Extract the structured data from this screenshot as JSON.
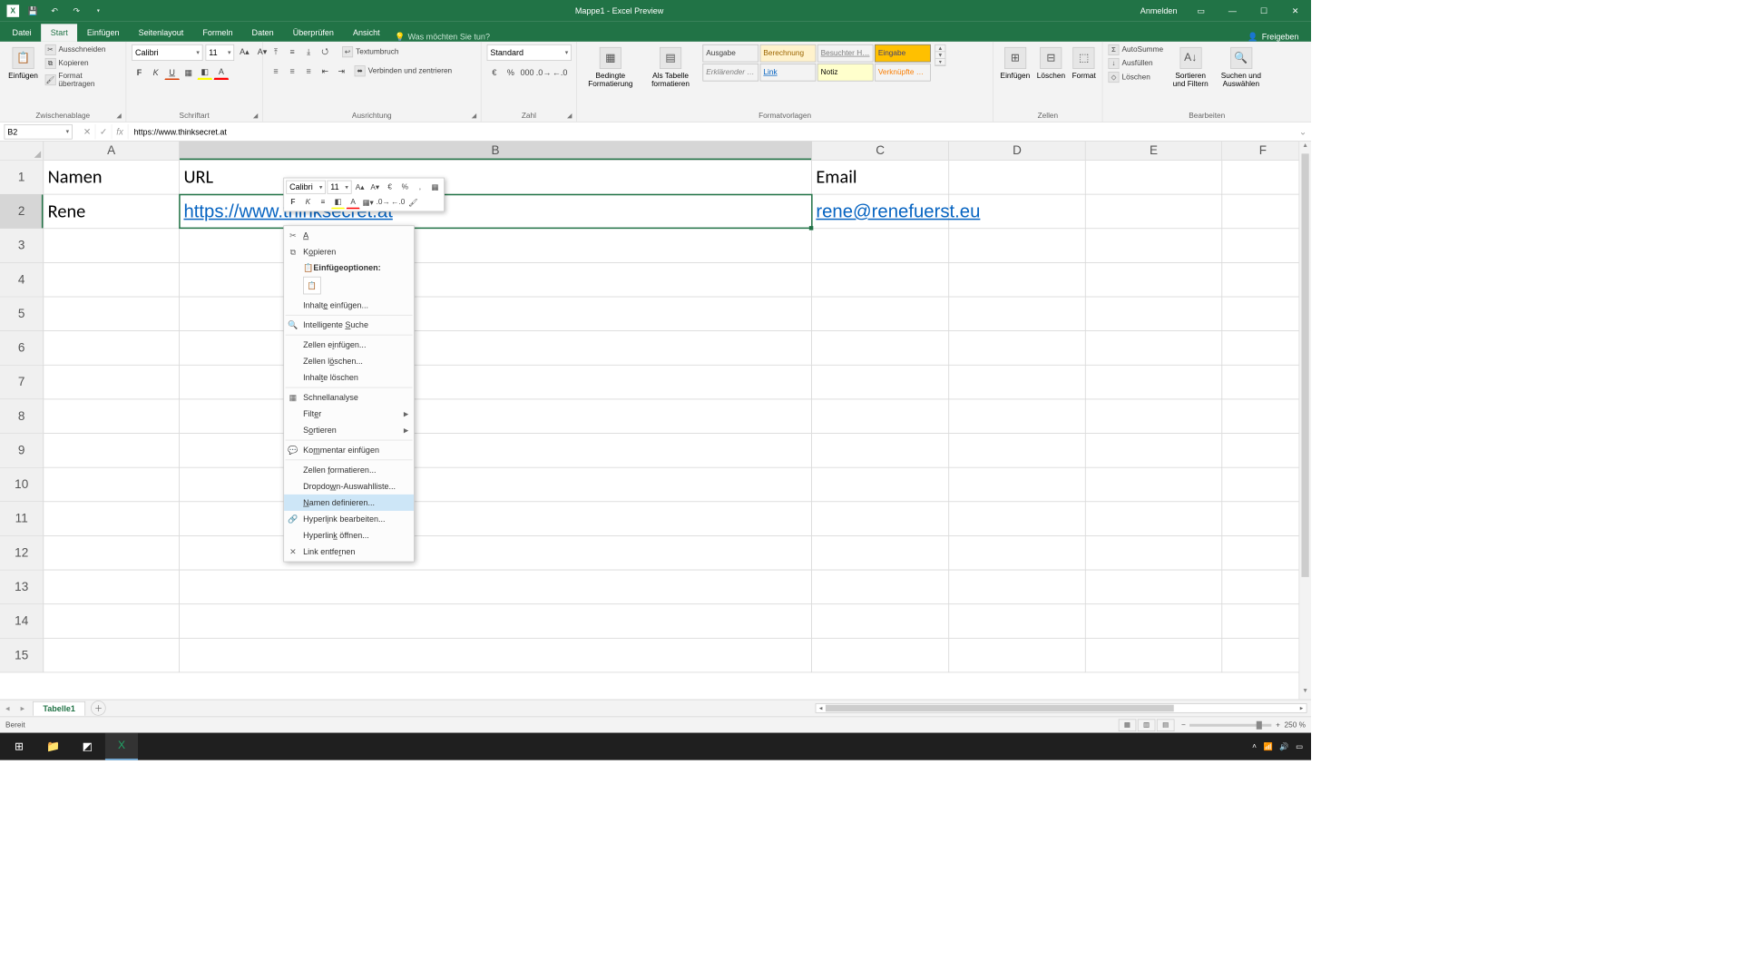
{
  "title": "Mappe1 - Excel Preview",
  "account": "Anmelden",
  "tabs": {
    "file": "Datei",
    "home": "Start",
    "insert": "Einfügen",
    "layout": "Seitenlayout",
    "formulas": "Formeln",
    "data": "Daten",
    "review": "Überprüfen",
    "view": "Ansicht",
    "tellme": "Was möchten Sie tun?"
  },
  "share": "Freigeben",
  "ribbon": {
    "clipboard": {
      "paste": "Einfügen",
      "cut": "Ausschneiden",
      "copy": "Kopieren",
      "painter": "Format übertragen",
      "label": "Zwischenablage"
    },
    "font": {
      "name": "Calibri",
      "size": "11",
      "label": "Schriftart"
    },
    "align": {
      "wrap": "Textumbruch",
      "merge": "Verbinden und zentrieren",
      "label": "Ausrichtung"
    },
    "number": {
      "format": "Standard",
      "label": "Zahl"
    },
    "styles": {
      "cond": "Bedingte Formatierung",
      "table": "Als Tabelle formatieren",
      "ausgabe": "Ausgabe",
      "berechnung": "Berechnung",
      "besucht": "Besuchter H…",
      "eingabe": "Eingabe",
      "erkl": "Erklärender …",
      "link": "Link",
      "notiz": "Notiz",
      "verkn": "Verknüpfte …",
      "label": "Formatvorlagen"
    },
    "cells": {
      "insert": "Einfügen",
      "delete": "Löschen",
      "format": "Format",
      "label": "Zellen"
    },
    "editing": {
      "autosum": "AutoSumme",
      "fill": "Ausfüllen",
      "clear": "Löschen",
      "sort": "Sortieren und Filtern",
      "find": "Suchen und Auswählen",
      "label": "Bearbeiten"
    }
  },
  "namebox": "B2",
  "formula": "https://www.thinksecret.at",
  "columns": [
    "A",
    "B",
    "C",
    "D",
    "E",
    "F"
  ],
  "data_rows": [
    {
      "n": "1",
      "A": "Namen",
      "B": "URL",
      "C": "Email"
    },
    {
      "n": "2",
      "A": "Rene",
      "B": "https://www.thinksecret.at",
      "C": "rene@renefuerst.eu",
      "link": true
    }
  ],
  "empty_rows": [
    "3",
    "4",
    "5",
    "6",
    "7",
    "8",
    "9",
    "10",
    "11",
    "12",
    "13",
    "14",
    "15"
  ],
  "mini": {
    "font": "Calibri",
    "size": "11"
  },
  "ctx": {
    "cut": "Ausschneiden",
    "copy": "Kopieren",
    "paste_opts": "Einfügeoptionen:",
    "paste_special": "Inhalte einfügen...",
    "smart": "Intelligente Suche",
    "ins": "Zellen einfügen...",
    "del": "Zellen löschen...",
    "clear": "Inhalte löschen",
    "quick": "Schnellanalyse",
    "filter": "Filter",
    "sort": "Sortieren",
    "comment": "Kommentar einfügen",
    "fmt": "Zellen formatieren...",
    "dropdown": "Dropdown-Auswahlliste...",
    "name": "Namen definieren...",
    "hedit": "Hyperlink bearbeiten...",
    "hopen": "Hyperlink öffnen...",
    "hremove": "Link entfernen"
  },
  "sheet": "Tabelle1",
  "status": "Bereit",
  "zoom": "250 %"
}
